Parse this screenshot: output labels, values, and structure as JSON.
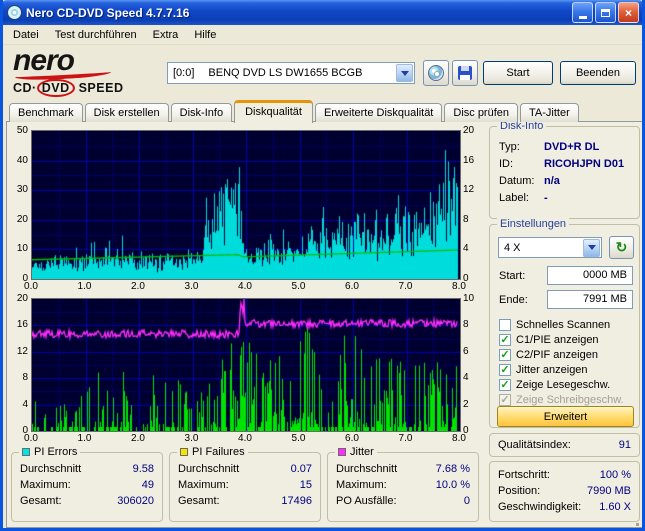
{
  "window": {
    "title": "Nero CD-DVD Speed 4.7.7.16"
  },
  "menu": {
    "items": [
      "Datei",
      "Test durchführen",
      "Extra",
      "Hilfe"
    ]
  },
  "logo": {
    "word": "nero",
    "sub1": "CD·",
    "sub2": "DVD",
    "sub3": " SPEED"
  },
  "toolbar": {
    "drive_bus": "[0:0]",
    "drive_name": "BENQ DVD LS DW1655 BCGB",
    "start": "Start",
    "beenden": "Beenden"
  },
  "tabs": [
    {
      "label": "Benchmark",
      "active": false
    },
    {
      "label": "Disk erstellen",
      "active": false
    },
    {
      "label": "Disk-Info",
      "active": false
    },
    {
      "label": "Diskqualität",
      "active": true
    },
    {
      "label": "Erweiterte Diskqualität",
      "active": false
    },
    {
      "label": "Disc prüfen",
      "active": false
    },
    {
      "label": "TA-Jitter",
      "active": false
    }
  ],
  "disk_info": {
    "title": "Disk-Info",
    "rows": [
      {
        "label": "Typ:",
        "value": "DVD+R DL"
      },
      {
        "label": "ID:",
        "value": "RICOHJPN D01"
      },
      {
        "label": "Datum:",
        "value": "n/a"
      },
      {
        "label": "Label:",
        "value": "-"
      }
    ]
  },
  "settings": {
    "title": "Einstellungen",
    "speed": "4 X",
    "start_label": "Start:",
    "start_value": "0000 MB",
    "end_label": "Ende:",
    "end_value": "7991 MB",
    "checkboxes": [
      {
        "label": "Schnelles Scannen",
        "checked": false,
        "disabled": false
      },
      {
        "label": "C1/PIE anzeigen",
        "checked": true,
        "disabled": false
      },
      {
        "label": "C2/PIF anzeigen",
        "checked": true,
        "disabled": false
      },
      {
        "label": "Jitter anzeigen",
        "checked": true,
        "disabled": false
      },
      {
        "label": "Zeige Lesegeschw.",
        "checked": true,
        "disabled": false
      },
      {
        "label": "Zeige Schreibgeschw.",
        "checked": true,
        "disabled": true
      }
    ],
    "erweitert": "Erweitert"
  },
  "quality": {
    "label": "Qualitätsindex:",
    "value": "91"
  },
  "stats": [
    {
      "title": "PI Errors",
      "swatch": "#00E5E5",
      "rows": [
        [
          "Durchschnitt",
          "9.58"
        ],
        [
          "Maximum:",
          "49"
        ],
        [
          "Gesamt:",
          "306020"
        ]
      ]
    },
    {
      "title": "PI Failures",
      "swatch": "#F5E500",
      "rows": [
        [
          "Durchschnitt",
          "0.07"
        ],
        [
          "Maximum:",
          "15"
        ],
        [
          "Gesamt:",
          "17496"
        ]
      ]
    },
    {
      "title": "Jitter",
      "swatch": "#FF2CFF",
      "rows": [
        [
          "Durchschnitt",
          "7.68 %"
        ],
        [
          "Maximum:",
          "10.0 %"
        ],
        [
          "PO Ausfälle:",
          "0"
        ]
      ]
    }
  ],
  "progress": {
    "rows": [
      [
        "Fortschritt:",
        "100 %"
      ],
      [
        "Position:",
        "7990 MB"
      ],
      [
        "Geschwindigkeit:",
        "1.60 X"
      ]
    ]
  },
  "charts": {
    "x_ticks": [
      "0.0",
      "1.0",
      "2.0",
      "3.0",
      "4.0",
      "5.0",
      "6.0",
      "7.0",
      "8.0"
    ],
    "x_max": 8,
    "data_end": 7.96,
    "bg": "#000030",
    "grid_minor": "#000068",
    "grid_major": "#0000AE",
    "top": {
      "left_ticks": [
        "50",
        "40",
        "30",
        "20",
        "10",
        "0"
      ],
      "left_max": 50,
      "right_ticks": [
        "20",
        "16",
        "12",
        "8",
        "4",
        "0"
      ],
      "right_max": 20,
      "h_minor": 5,
      "h_major": 10,
      "series_color": "#00DCDC",
      "line_color": "#00BE00",
      "seed": 20105,
      "segments": [
        {
          "x0": 0.0,
          "x1": 0.7,
          "b0": 3,
          "b1": 6,
          "noise": 7,
          "spike": 0.05,
          "smax": 8
        },
        {
          "x0": 0.7,
          "x1": 3.2,
          "b0": 5,
          "b1": 7,
          "noise": 7,
          "spike": 0.08,
          "smax": 10
        },
        {
          "x0": 3.2,
          "x1": 3.5,
          "b0": 8,
          "b1": 26,
          "noise": 16,
          "spike": 0.45,
          "smax": 14
        },
        {
          "x0": 3.5,
          "x1": 3.95,
          "b0": 26,
          "b1": 18,
          "noise": 20,
          "spike": 0.55,
          "smax": 14
        },
        {
          "x0": 3.95,
          "x1": 5.2,
          "b0": 7,
          "b1": 12,
          "noise": 9,
          "spike": 0.12,
          "smax": 8
        },
        {
          "x0": 5.2,
          "x1": 7.55,
          "b0": 11,
          "b1": 20,
          "noise": 13,
          "spike": 0.2,
          "smax": 10
        },
        {
          "x0": 7.55,
          "x1": 7.96,
          "b0": 18,
          "b1": 30,
          "noise": 16,
          "spike": 0.5,
          "smax": 16
        }
      ],
      "line_points": [
        [
          0,
          2.6
        ],
        [
          3.85,
          3.3
        ],
        [
          3.95,
          3.0
        ],
        [
          7.9,
          3.9
        ],
        [
          7.96,
          3.9
        ]
      ]
    },
    "bottom": {
      "left_ticks": [
        "20",
        "16",
        "12",
        "8",
        "4",
        "0"
      ],
      "left_max": 20,
      "right_ticks": [
        "10",
        "8",
        "6",
        "4",
        "2",
        "0"
      ],
      "right_max": 10,
      "h_minor": 2,
      "h_major": 4,
      "series_color": "#00E400",
      "line_color": "#FF2CFF",
      "seed": 911,
      "segments": [
        {
          "x0": 0.0,
          "x1": 1.2,
          "density": 0.3,
          "max": 6
        },
        {
          "x0": 1.2,
          "x1": 3.5,
          "density": 0.38,
          "max": 8
        },
        {
          "x0": 3.5,
          "x1": 4.7,
          "density": 0.75,
          "max": 13
        },
        {
          "x0": 4.7,
          "x1": 6.2,
          "density": 0.65,
          "max": 15
        },
        {
          "x0": 6.2,
          "x1": 7.96,
          "density": 0.55,
          "max": 10
        }
      ],
      "jitter_segments": [
        {
          "x0": 0.0,
          "x1": 3.88,
          "base": 7.35,
          "noise": 0.3
        },
        {
          "x0": 3.88,
          "x1": 3.98,
          "base": 9.4,
          "noise": 0.6
        },
        {
          "x0": 3.98,
          "x1": 7.96,
          "base": 8.15,
          "noise": 0.3
        }
      ]
    }
  }
}
